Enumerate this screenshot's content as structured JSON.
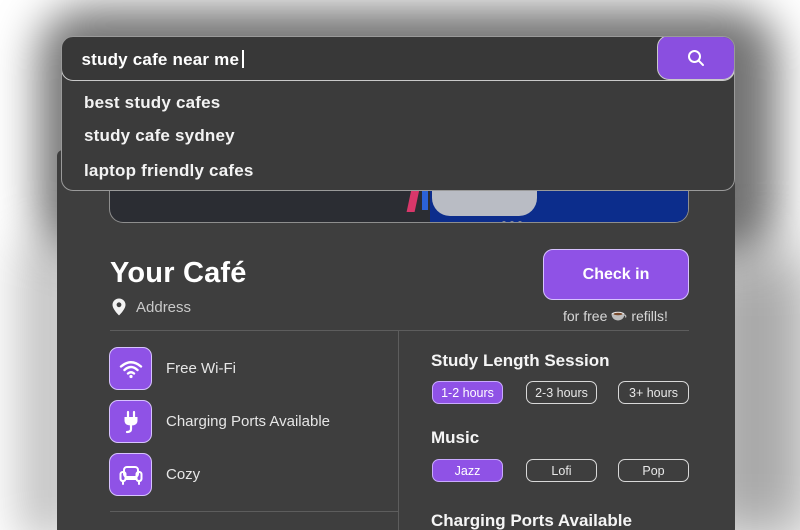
{
  "search": {
    "query": "study cafe near me",
    "suggestions": [
      "best study cafes",
      "study cafe sydney",
      "laptop friendly cafes"
    ]
  },
  "cafe": {
    "name": "Your Café",
    "address": "Address",
    "checkin_label": "Check in",
    "refill_prefix": "for free",
    "refill_suffix": "refills!"
  },
  "amenities": [
    {
      "label": "Free Wi-Fi",
      "icon": "wifi-icon"
    },
    {
      "label": "Charging Ports Available",
      "icon": "plug-icon"
    },
    {
      "label": "Cozy",
      "icon": "armchair-icon"
    }
  ],
  "filters": {
    "study_length": {
      "title": "Study Length Session",
      "options": [
        "1-2 hours",
        "2-3 hours",
        "3+ hours"
      ],
      "selected": "1-2 hours"
    },
    "music": {
      "title": "Music",
      "options": [
        "Jazz",
        "Lofi",
        "Pop"
      ],
      "selected": "Jazz"
    },
    "charging": {
      "title": "Charging Ports Available"
    }
  },
  "colors": {
    "accent": "#8f52e6",
    "card_bg": "#3e3e3e",
    "panel_bg": "#3b3b3b"
  }
}
